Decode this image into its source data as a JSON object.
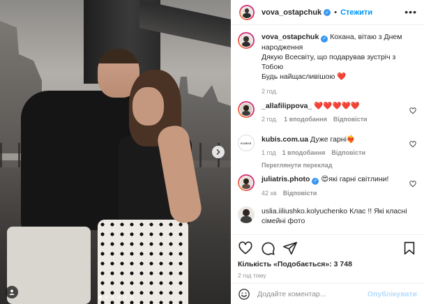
{
  "colors": {
    "accent": "#0095f6",
    "verified": "#3897f0",
    "heart": "#ed4956",
    "muted": "#8e8e8e"
  },
  "carousel": {
    "dot_count": 6,
    "active_dot": 0
  },
  "header": {
    "username": "vova_ostapchuk",
    "separator": "•",
    "follow_label": "Стежити",
    "more_icon": "more-icon",
    "verified_icon": "verified-badge-icon"
  },
  "caption": {
    "username": "vova_ostapchuk",
    "line1": "Кохана, вітаю з Днем народження",
    "line2": "Дякую Всесвіту, що подарував зустріч з Тобою",
    "line3": "Будь найщасливішою",
    "emoji": "❤️",
    "time": "2 год."
  },
  "comments": [
    {
      "username": "_allafilippova_",
      "text": "❤️❤️❤️❤️❤️",
      "time": "2 год.",
      "likes": "1 вподобання",
      "reply": "Відповісти"
    },
    {
      "username": "kubis.com.ua",
      "avatar_text": "KUBIS",
      "text": "Дуже гарні❤️‍🔥",
      "time": "1 год",
      "likes": "1 вподобання",
      "reply": "Відповісти",
      "translate": "Переглянути переклад"
    },
    {
      "username": "juliatris.photo",
      "text": "😍які гарні світлини!",
      "time": "42 хв",
      "reply": "Відповісти"
    },
    {
      "username": "uslia.iiliushko.kolyuchenko",
      "text": "Клас !! Які класні сімейні фото"
    }
  ],
  "actions": {
    "like_icon": "heart-icon",
    "comment_icon": "comment-icon",
    "share_icon": "share-icon",
    "save_icon": "bookmark-icon",
    "likes_text": "Кількість «Подобається»: 3 748",
    "ago": "2 год тому"
  },
  "add_comment": {
    "placeholder": "Додайте коментар...",
    "publish_label": "Опублікувати",
    "emoji_icon": "emoji-icon"
  }
}
